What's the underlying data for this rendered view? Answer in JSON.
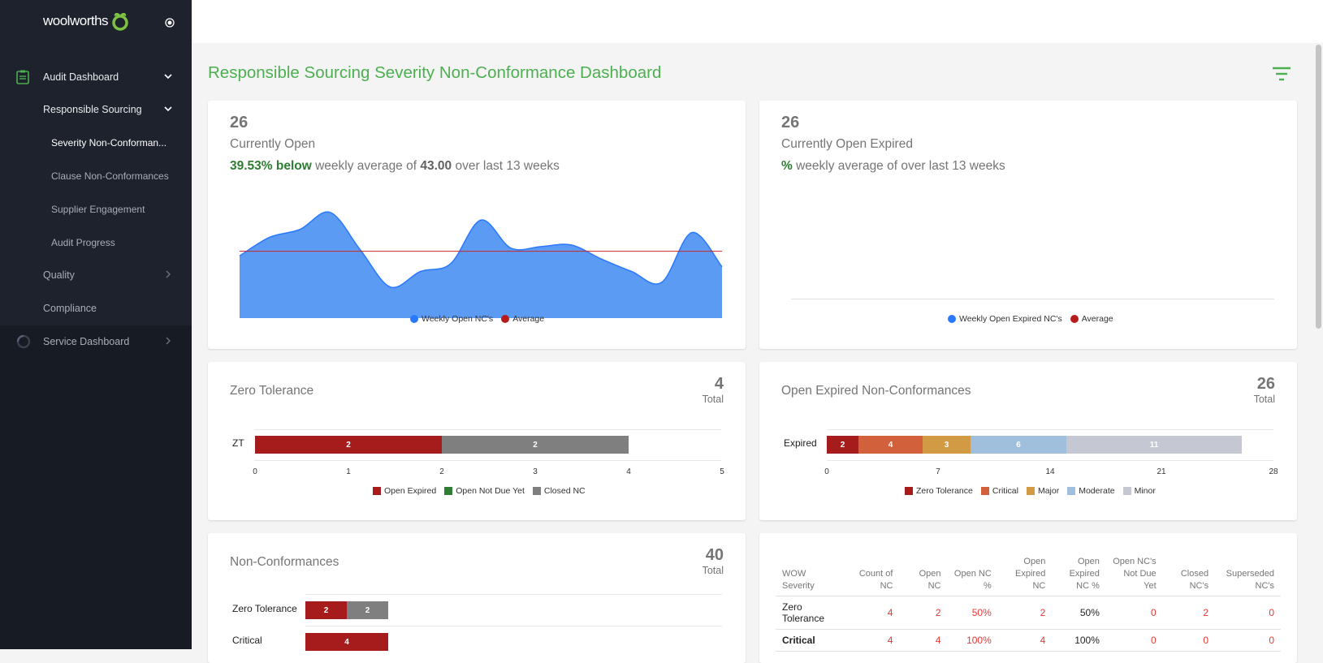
{
  "sidebar": {
    "logo_text": "woolworths",
    "items": [
      {
        "label": "Audit Dashboard",
        "icon": "clipboard-icon"
      },
      {
        "label": "Responsible Sourcing"
      },
      {
        "label": "Severity Non-Conforman..."
      },
      {
        "label": "Clause Non-Conformances"
      },
      {
        "label": "Supplier Engagement"
      },
      {
        "label": "Audit Progress"
      },
      {
        "label": "Quality"
      },
      {
        "label": "Compliance"
      },
      {
        "label": "Service Dashboard",
        "icon": "loading-circle-icon"
      }
    ]
  },
  "page": {
    "title": "Responsible Sourcing Severity Non-Conformance Dashboard"
  },
  "open_card": {
    "count": "26",
    "label": "Currently Open",
    "pct": "39.53% below",
    "mid": "weekly average of",
    "avg": "43.00",
    "tail": "over last 13 weeks",
    "legend": [
      "Weekly Open NC's",
      "Average"
    ]
  },
  "expired_card": {
    "count": "26",
    "label": "Currently Open Expired",
    "pct": "%",
    "text": "weekly average of over last 13 weeks",
    "legend": [
      "Weekly Open Expired NC's",
      "Average"
    ]
  },
  "zero_card": {
    "title": "Zero Tolerance",
    "total": "4",
    "total_label": "Total",
    "ylabel": "ZT",
    "ticks": [
      "0",
      "1",
      "2",
      "3",
      "4",
      "5"
    ],
    "legend": [
      "Open Expired",
      "Open Not Due Yet",
      "Closed NC"
    ]
  },
  "expired_nc_card": {
    "title": "Open Expired Non-Conformances",
    "total": "26",
    "total_label": "Total",
    "ylabel": "Expired",
    "ticks": [
      "0",
      "7",
      "14",
      "21",
      "28"
    ],
    "legend": [
      "Zero Tolerance",
      "Critical",
      "Major",
      "Moderate",
      "Minor"
    ]
  },
  "nc_card": {
    "title": "Non-Conformances",
    "total": "40",
    "total_label": "Total",
    "rows": [
      "Zero Tolerance",
      "Critical"
    ]
  },
  "table": {
    "headers": [
      "WOW Severity",
      "Count of NC",
      "Open NC",
      "Open NC %",
      "Open Expired NC",
      "Open Expired NC %",
      "Open NC's Not Due Yet",
      "Closed NC's",
      "Superseded NC's"
    ],
    "rows": [
      [
        "Zero Tolerance",
        "4",
        "2",
        "50%",
        "2",
        "50%",
        "0",
        "2",
        "0"
      ],
      [
        "Critical",
        "4",
        "4",
        "100%",
        "4",
        "100%",
        "0",
        "0",
        "0"
      ]
    ]
  },
  "colors": {
    "accent": "#4caf50",
    "blue": "#2979ff",
    "red": "#b71c1c",
    "grey": "#7f7f7f"
  },
  "chart_data": [
    {
      "type": "area",
      "series": [
        {
          "name": "Weekly Open NC's",
          "values": [
            40,
            52,
            57,
            68,
            44,
            20,
            30,
            35,
            63,
            45,
            46,
            47,
            38,
            30,
            23,
            55,
            33
          ]
        },
        {
          "name": "Average",
          "values": [
            43
          ]
        }
      ],
      "legend": "bottom"
    },
    {
      "type": "bar",
      "categories": [
        "ZT"
      ],
      "series": [
        {
          "name": "Open Expired",
          "values": [
            2
          ]
        },
        {
          "name": "Open Not Due Yet",
          "values": [
            0
          ]
        },
        {
          "name": "Closed NC",
          "values": [
            2
          ]
        }
      ],
      "xlim": [
        0,
        5
      ]
    },
    {
      "type": "bar",
      "categories": [
        "Expired"
      ],
      "series": [
        {
          "name": "Zero Tolerance",
          "values": [
            2
          ]
        },
        {
          "name": "Critical",
          "values": [
            4
          ]
        },
        {
          "name": "Major",
          "values": [
            3
          ]
        },
        {
          "name": "Moderate",
          "values": [
            6
          ]
        },
        {
          "name": "Minor",
          "values": [
            11
          ]
        }
      ],
      "xlim": [
        0,
        28
      ]
    },
    {
      "type": "bar",
      "categories": [
        "Zero Tolerance",
        "Critical"
      ],
      "series": [
        {
          "name": "Open Expired",
          "values": [
            2,
            4
          ]
        },
        {
          "name": "Closed NC",
          "values": [
            2,
            0
          ]
        }
      ]
    }
  ]
}
